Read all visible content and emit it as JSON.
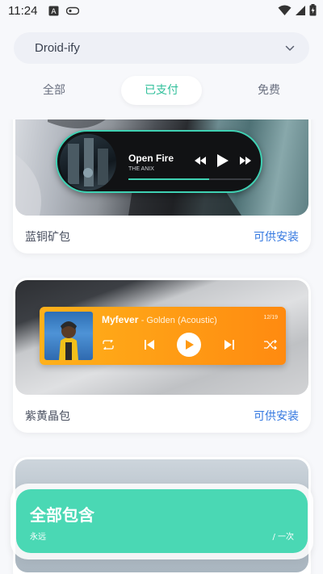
{
  "status_bar": {
    "time": "11:24"
  },
  "dropdown": {
    "value": "Droid-ify"
  },
  "tabs": [
    {
      "label": "全部"
    },
    {
      "label": "已支付",
      "selected": true
    },
    {
      "label": "免费"
    }
  ],
  "cards": [
    {
      "name": "蓝铜矿包",
      "action": "可供安装",
      "player": {
        "title": "Open Fire",
        "artist": "THE ANIX",
        "progress": 0.66
      }
    },
    {
      "name": "紫黄晶包",
      "action": "可供安装",
      "player": {
        "artist": "Myfever",
        "title": "- Golden (Acoustic)",
        "counter": "12/19"
      }
    }
  ],
  "summary": {
    "title": "全部包含",
    "period": "永远",
    "price": "/ 一次"
  },
  "colors": {
    "accent": "#4ad8b4",
    "link": "#3478e0",
    "player_orange": "#ff9a14"
  }
}
